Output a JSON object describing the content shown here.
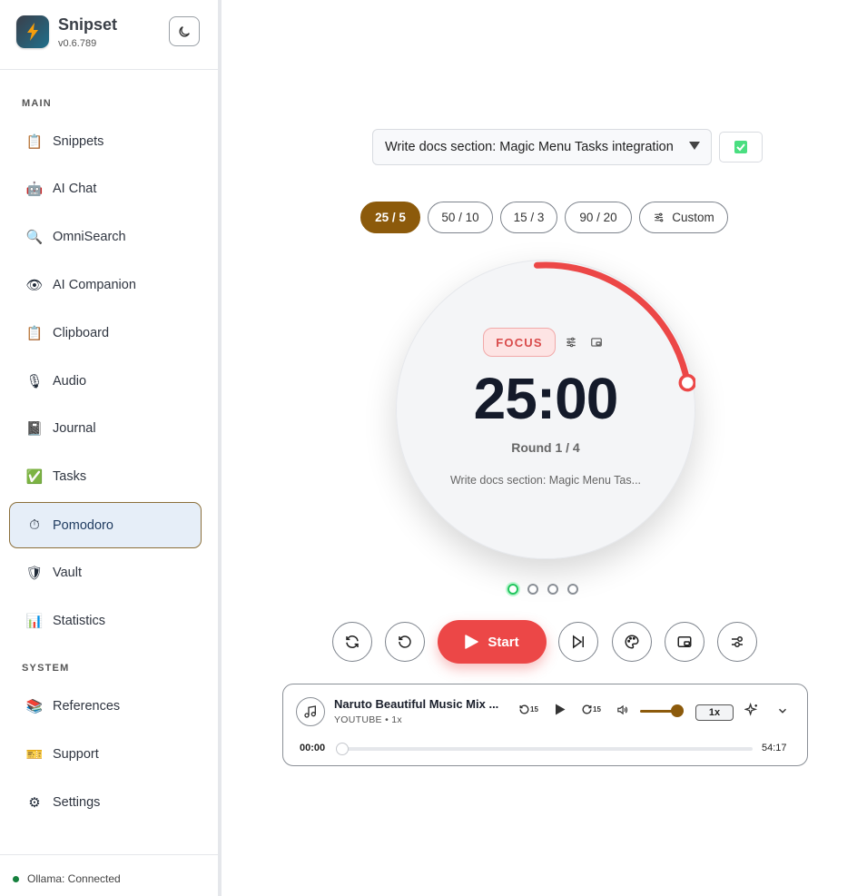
{
  "app": {
    "name": "Snipset",
    "version": "v0.6.789"
  },
  "sidebar": {
    "sections": {
      "main": "MAIN",
      "system": "SYSTEM"
    },
    "main_items": [
      {
        "label": "Snippets",
        "icon": "clipboard-icon"
      },
      {
        "label": "AI Chat",
        "icon": "robot-icon"
      },
      {
        "label": "OmniSearch",
        "icon": "magnifier-icon"
      },
      {
        "label": "AI Companion",
        "icon": "eye-icon"
      },
      {
        "label": "Clipboard",
        "icon": "clipboard-icon"
      },
      {
        "label": "Audio",
        "icon": "microphone-icon"
      },
      {
        "label": "Journal",
        "icon": "notebook-icon"
      },
      {
        "label": "Tasks",
        "icon": "check-box-icon"
      },
      {
        "label": "Pomodoro",
        "icon": "stopwatch-icon",
        "active": true
      },
      {
        "label": "Vault",
        "icon": "shield-icon"
      },
      {
        "label": "Statistics",
        "icon": "bar-chart-icon"
      }
    ],
    "system_items": [
      {
        "label": "References",
        "icon": "books-icon"
      },
      {
        "label": "Support",
        "icon": "ticket-icon"
      },
      {
        "label": "Settings",
        "icon": "gear-icon"
      }
    ],
    "status": "Ollama: Connected"
  },
  "pomodoro": {
    "selected_task": "Write docs section: Magic Menu Tasks integration",
    "presets": [
      "25 / 5",
      "50 / 10",
      "15 / 3",
      "90 / 20",
      "Custom"
    ],
    "active_preset": "25 / 5",
    "mode": "FOCUS",
    "time": "25:00",
    "round": "Round 1 / 4",
    "task_preview": "Write docs section: Magic Menu Tas...",
    "start_label": "Start",
    "rounds_total": 4,
    "current_round": 1,
    "ring_progress": 0.23,
    "colors": {
      "accent": "#8c5a0b",
      "focus": "#ec4747",
      "success": "#22c55e"
    }
  },
  "player": {
    "title": "Naruto Beautiful Music Mix ...",
    "meta": "YOUTUBE • 1x",
    "rewind_label": "15",
    "forward_label": "15",
    "speed": "1x",
    "current_time": "00:00",
    "duration": "54:17",
    "volume": 0.85,
    "progress": 0.0
  }
}
